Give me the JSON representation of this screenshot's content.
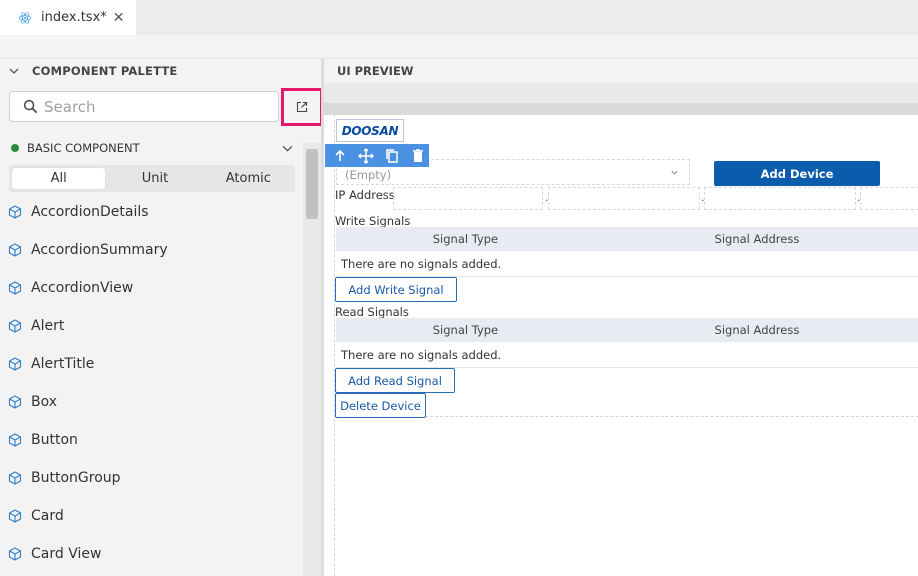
{
  "tab": {
    "name": "index.tsx*",
    "icon": "react-icon",
    "close": "✕"
  },
  "palette": {
    "title": "COMPONENT PALETTE",
    "search_placeholder": "Search",
    "section_label": "BASIC COMPONENT",
    "filters": [
      "All",
      "Unit",
      "Atomic"
    ],
    "active_filter": "All",
    "components": [
      "AccordionDetails",
      "AccordionSummary",
      "AccordionView",
      "Alert",
      "AlertTitle",
      "Box",
      "Button",
      "ButtonGroup",
      "Card",
      "Card View"
    ]
  },
  "preview": {
    "title": "UI PREVIEW",
    "logo_text": "DOOSAN",
    "select_value": "(Empty)",
    "add_device": "Add Device",
    "ip_label": "IP Address",
    "ip_separators": [
      ".",
      ".",
      "."
    ],
    "write_signals_label": "Write Signals",
    "read_signals_label": "Read Signals",
    "table_columns": [
      "Signal Type",
      "Signal Address"
    ],
    "empty_message": "There are no signals added.",
    "add_write_signal": "Add Write Signal",
    "add_read_signal": "Add Read Signal",
    "delete_device": "Delete Device"
  },
  "colors": {
    "highlight": "#e5166d",
    "primary": "#0b5cad",
    "toolbar": "#4b91e2",
    "section_dot": "#2e8b3a"
  }
}
